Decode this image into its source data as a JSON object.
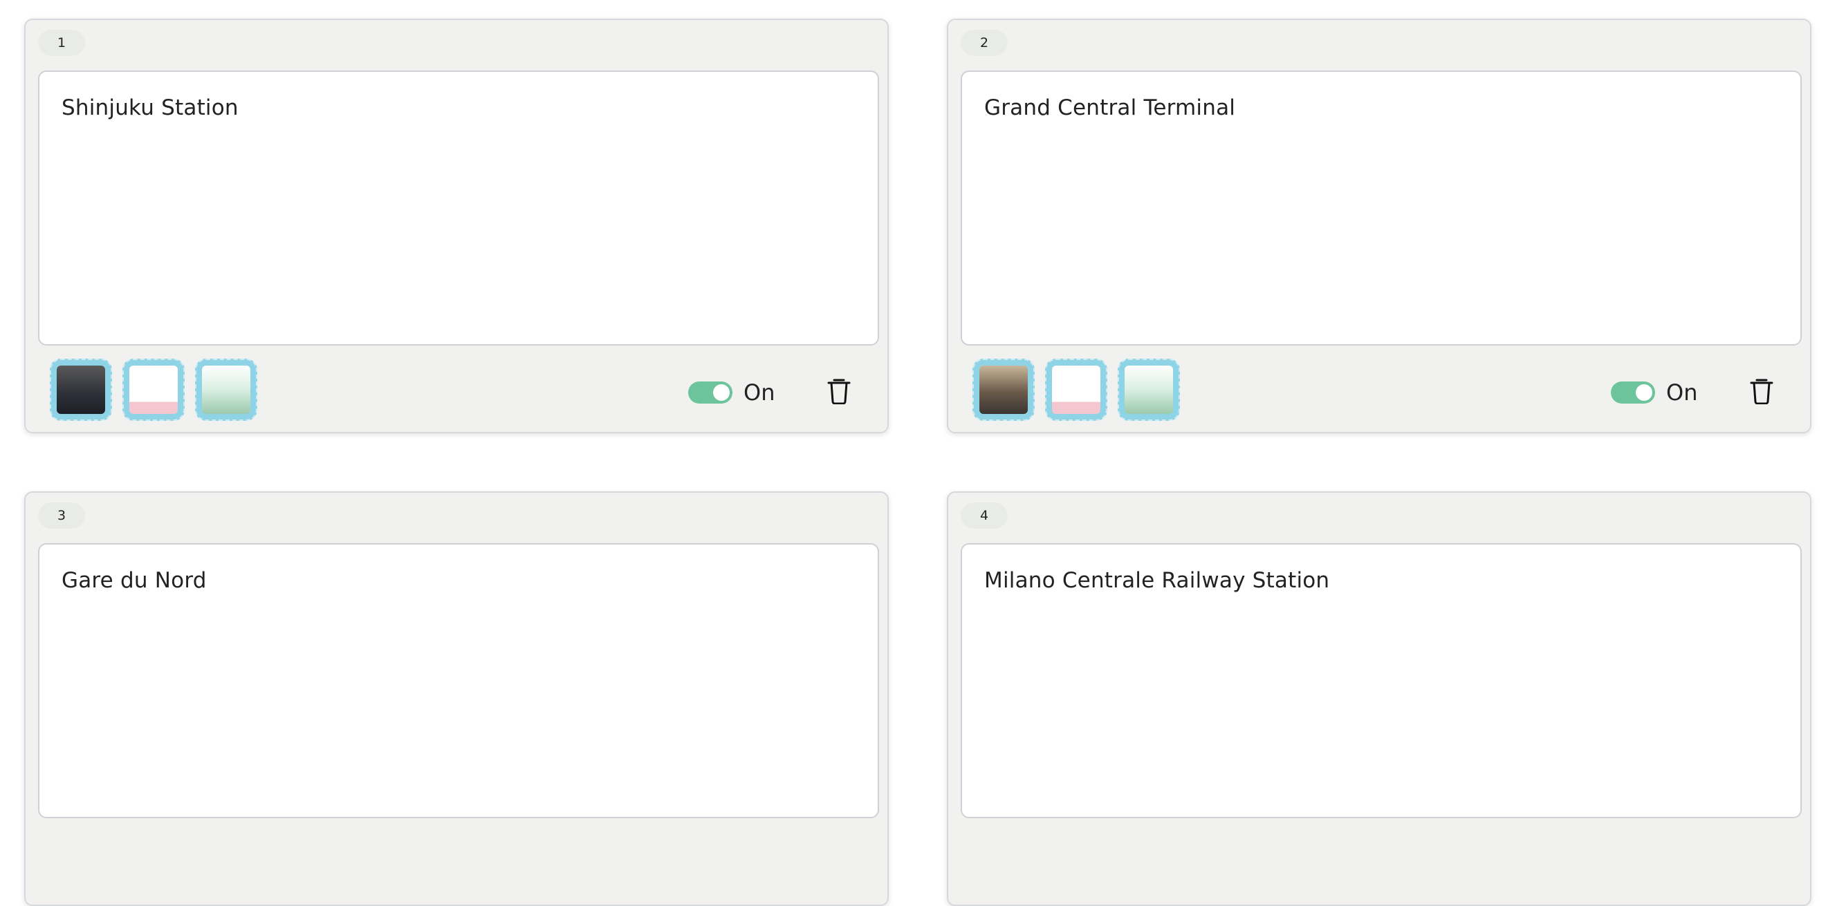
{
  "cards": [
    {
      "index": "1",
      "title": "Shinjuku Station",
      "thumbnails": [
        "photo",
        "text-card",
        "box-image"
      ],
      "toggle": {
        "state": "on",
        "label": "On"
      }
    },
    {
      "index": "2",
      "title": "Grand Central Terminal",
      "thumbnails": [
        "photo",
        "text-card",
        "box-image"
      ],
      "toggle": {
        "state": "on",
        "label": "On"
      }
    },
    {
      "index": "3",
      "title": "Gare du Nord"
    },
    {
      "index": "4",
      "title": "Milano Centrale Railway Station"
    }
  ],
  "colors": {
    "card_bg": "#f1f2f0",
    "toggle_on": "#6cc39c",
    "thumb_frame": "#8fd4e6"
  },
  "icons": [
    "trash-icon"
  ]
}
